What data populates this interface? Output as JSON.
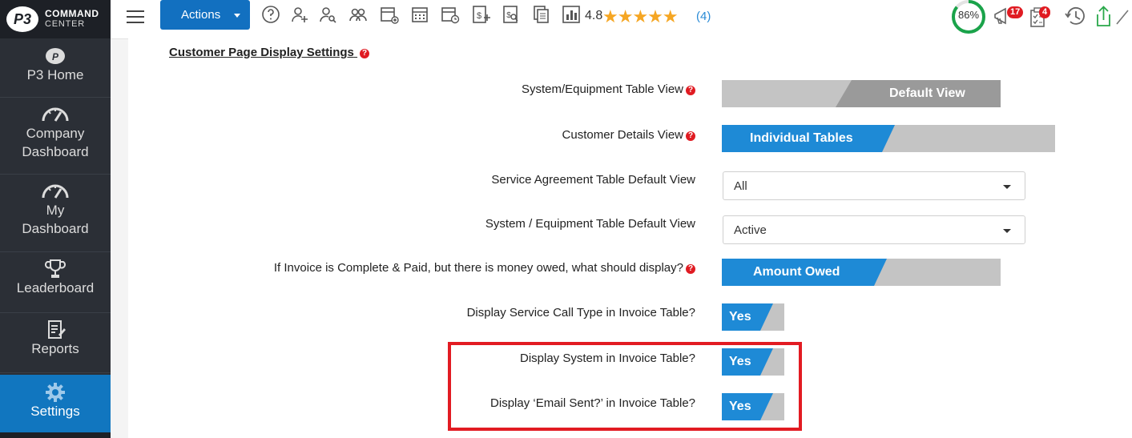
{
  "app": {
    "logo_badge": "P3",
    "logo_line1": "COMMAND",
    "logo_line2": "CENTER"
  },
  "sidebar": {
    "items": [
      {
        "label": "P3 Home",
        "icon": "p3-home-icon"
      },
      {
        "label": "Company Dashboard",
        "icon": "gauge-icon"
      },
      {
        "label": "My Dashboard",
        "icon": "gauge-icon"
      },
      {
        "label": "Leaderboard",
        "icon": "trophy-icon"
      },
      {
        "label": "Reports",
        "icon": "report-icon"
      },
      {
        "label": "Settings",
        "icon": "gear-icon",
        "active": true
      }
    ]
  },
  "topbar": {
    "actions_label": "Actions",
    "rating": "4.8",
    "stars": "★★★★★",
    "rating_count": "(4)",
    "progress": "86%",
    "progress_value": 0.86,
    "notification_count": "17",
    "task_count": "4"
  },
  "settings": {
    "section_title": "Customer Page Display Settings",
    "rows": [
      {
        "label": "System/Equipment Table View",
        "help": true,
        "control": "toggle",
        "value": "Default View"
      },
      {
        "label": "Customer Details View",
        "help": true,
        "control": "toggle",
        "value": "Individual Tables"
      },
      {
        "label": "Service Agreement Table Default View",
        "help": false,
        "control": "select",
        "value": "All"
      },
      {
        "label": "System / Equipment Table Default View",
        "help": false,
        "control": "select",
        "value": "Active"
      },
      {
        "label": "If Invoice is Complete & Paid, but there is money owed, what should display?",
        "help": true,
        "control": "toggle",
        "value": "Amount Owed"
      },
      {
        "label": "Display Service Call Type in Invoice Table?",
        "help": false,
        "control": "toggle",
        "value": "Yes"
      },
      {
        "label": "Display System in Invoice Table?",
        "help": false,
        "control": "toggle",
        "value": "Yes"
      },
      {
        "label": "Display ‘Email Sent?’ in Invoice Table?",
        "help": false,
        "control": "toggle",
        "value": "Yes"
      }
    ]
  },
  "colors": {
    "accent": "#1e8ad6",
    "sidebar_bg": "#2b2f36",
    "active_nav": "#1176bf",
    "highlight": "#e21b22",
    "progress": "#1aa34a"
  }
}
